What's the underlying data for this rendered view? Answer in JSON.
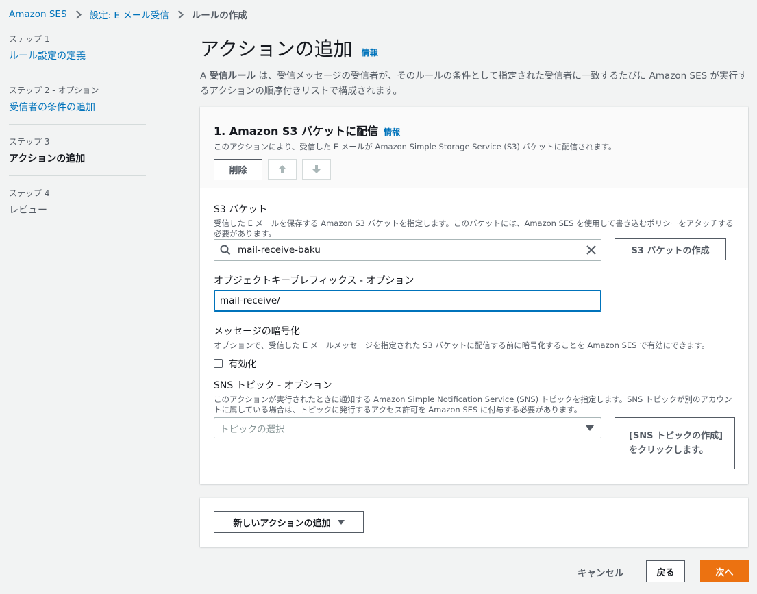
{
  "breadcrumb": {
    "items": [
      "Amazon SES",
      "設定: E メール受信"
    ],
    "current": "ルールの作成"
  },
  "steps": [
    {
      "num": "ステップ 1",
      "title": "ルール設定の定義"
    },
    {
      "num": "ステップ 2 - オプション",
      "title": "受信者の条件の追加"
    },
    {
      "num": "ステップ 3",
      "title": "アクションの追加"
    },
    {
      "num": "ステップ 4",
      "title": "レビュー"
    }
  ],
  "header": {
    "title": "アクションの追加",
    "info": "情報",
    "desc_prefix": "A ",
    "desc_bold": "受信ルール",
    "desc_rest": " は、受信メッセージの受信者が、そのルールの条件として指定された受信者に一致するたびに Amazon SES が実行するアクションの順序付きリストで構成されます。"
  },
  "action": {
    "title": "1. Amazon S3 バケットに配信",
    "info": "情報",
    "desc": "このアクションにより、受信した E メールが Amazon Simple Storage Service (S3) バケットに配信されます。",
    "delete_label": "削除"
  },
  "s3": {
    "label": "S3 バケット",
    "desc": "受信した E メールを保存する Amazon S3 バケットを指定します。このバケットには、Amazon SES を使用して書き込むポリシーをアタッチする必要があります。",
    "value": "mail-receive-baku",
    "create_label": "S3 バケットの作成"
  },
  "object_prefix": {
    "label": "オブジェクトキープレフィックス - オプション",
    "value": "mail-receive/"
  },
  "encryption": {
    "label": "メッセージの暗号化",
    "desc": "オプションで、受信した E メールメッセージを指定された S3 バケットに配信する前に暗号化することを Amazon SES で有効にできます。",
    "checkbox_label": "有効化"
  },
  "sns": {
    "label": "SNS トピック - オプション",
    "desc": "このアクションが実行されたときに通知する Amazon Simple Notification Service (SNS) トピックを指定します。SNS トピックが別のアカウントに属している場合は、トピックに発行するアクセス許可を Amazon SES に付与する必要があります。",
    "placeholder": "トピックの選択",
    "create_label": "[SNS トピックの作成] をクリックします。"
  },
  "add_action": {
    "label": "新しいアクションの追加"
  },
  "footer": {
    "cancel": "キャンセル",
    "back": "戻る",
    "next": "次へ"
  },
  "colors": {
    "link": "#0073bb",
    "primary_button": "#ec7211"
  }
}
